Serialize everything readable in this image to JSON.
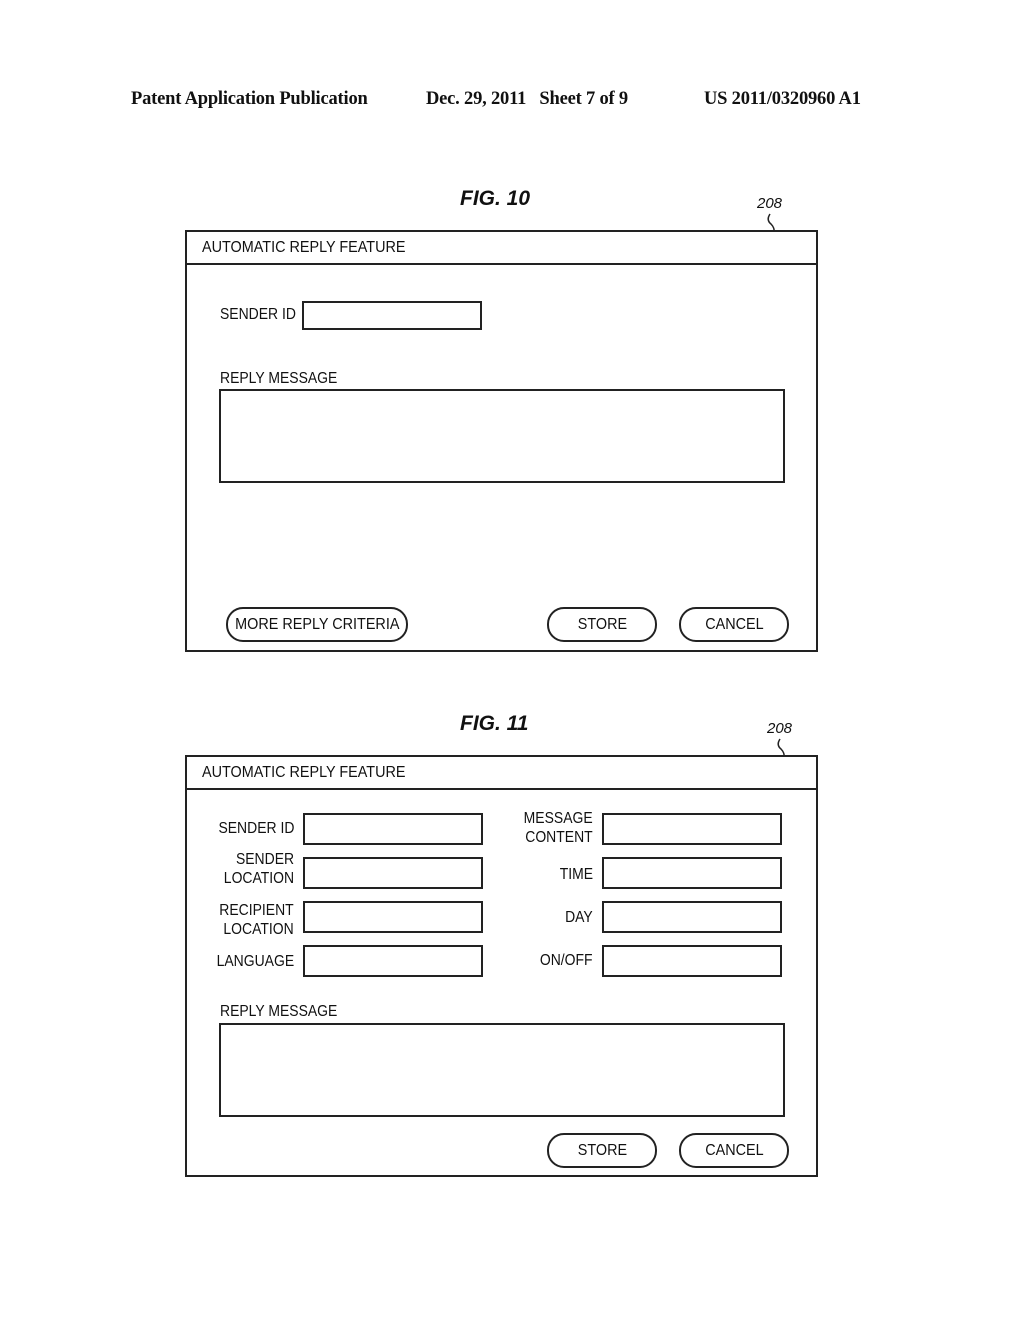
{
  "header": {
    "publication": "Patent Application Publication",
    "date_sheet": "Dec. 29, 2011   Sheet 7 of 9",
    "patent_number": "US 2011/0320960 A1"
  },
  "figures": [
    {
      "title": "FIG. 10",
      "ref_number": "208",
      "window_title": "AUTOMATIC REPLY FEATURE",
      "fields": [
        {
          "label": "SENDER ID",
          "value": ""
        }
      ],
      "reply_message": {
        "label": "REPLY MESSAGE",
        "value": ""
      },
      "buttons": {
        "more_criteria": "MORE REPLY CRITERIA",
        "store": "STORE",
        "cancel": "CANCEL"
      }
    },
    {
      "title": "FIG. 11",
      "ref_number": "208",
      "window_title": "AUTOMATIC REPLY FEATURE",
      "left_fields": [
        {
          "label_line1": "SENDER ID",
          "label_line2": "",
          "value": ""
        },
        {
          "label_line1": "SENDER",
          "label_line2": "LOCATION",
          "value": ""
        },
        {
          "label_line1": "RECIPIENT",
          "label_line2": "LOCATION",
          "value": ""
        },
        {
          "label_line1": "LANGUAGE",
          "label_line2": "",
          "value": ""
        }
      ],
      "right_fields": [
        {
          "label_line1": "MESSAGE",
          "label_line2": "CONTENT",
          "value": ""
        },
        {
          "label_line1": "TIME",
          "label_line2": "",
          "value": ""
        },
        {
          "label_line1": "DAY",
          "label_line2": "",
          "value": ""
        },
        {
          "label_line1": "ON/OFF",
          "label_line2": "",
          "value": ""
        }
      ],
      "reply_message": {
        "label": "REPLY MESSAGE",
        "value": ""
      },
      "buttons": {
        "store": "STORE",
        "cancel": "CANCEL"
      }
    }
  ]
}
